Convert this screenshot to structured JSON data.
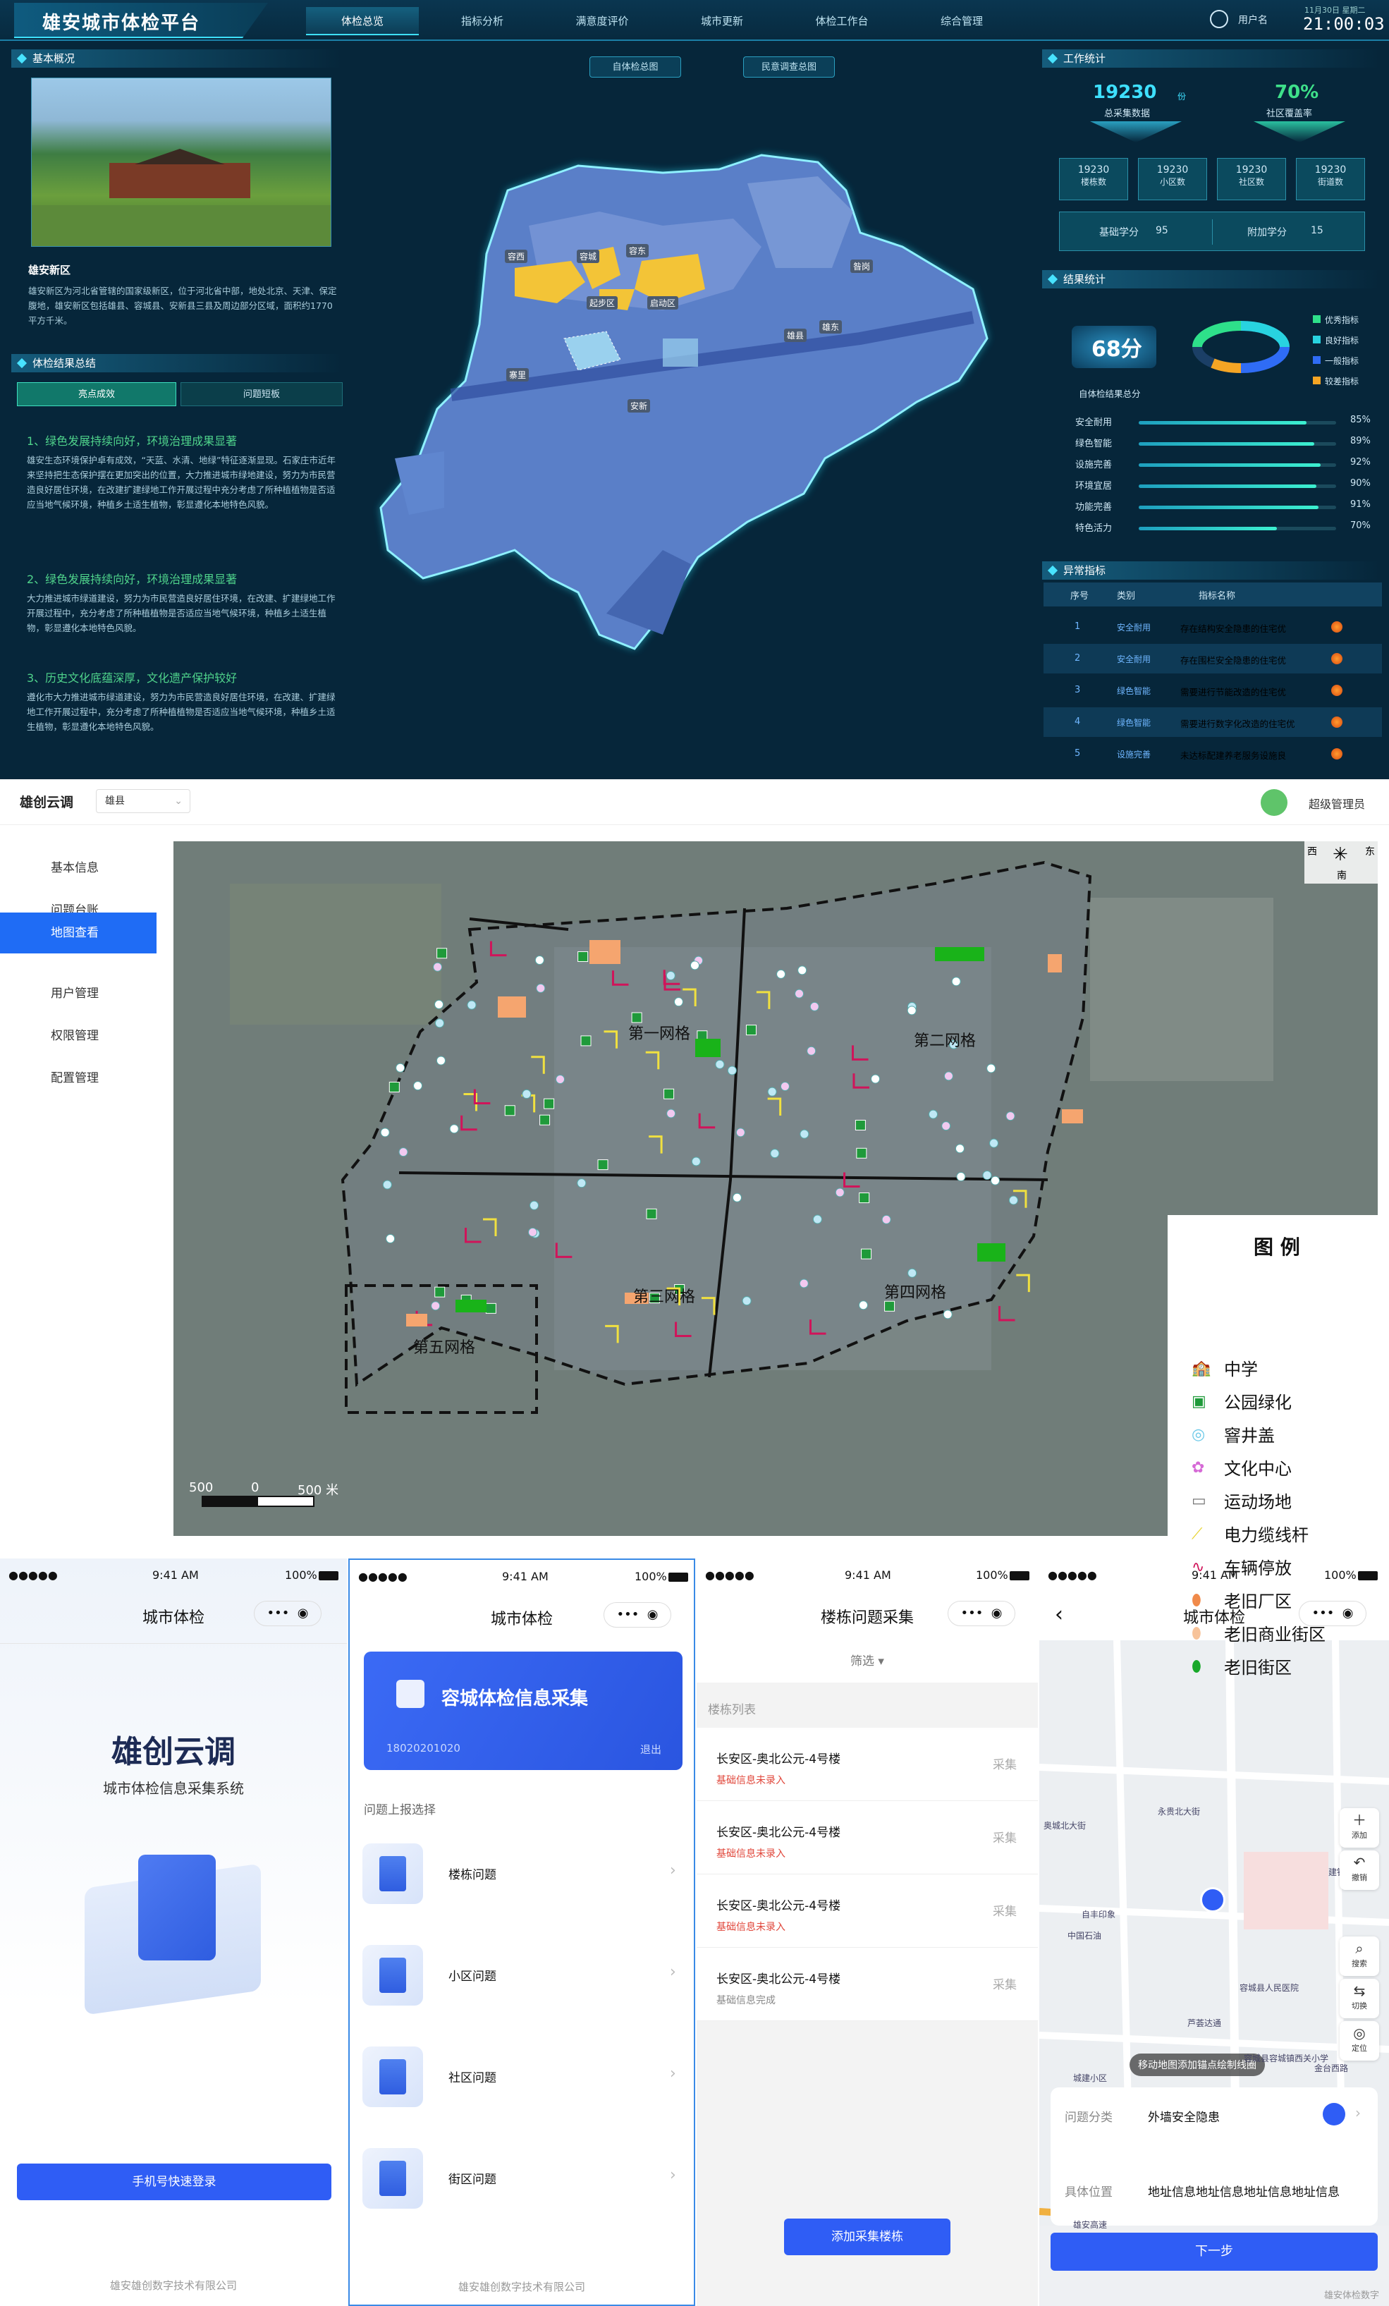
{
  "dashboard": {
    "title": "雄安城市体检平台",
    "nav": [
      "体检总览",
      "指标分析",
      "满意度评价",
      "城市更新",
      "体检工作台",
      "综合管理"
    ],
    "user": "用户名",
    "date": "11月30日 星期二",
    "time": "21:00:03",
    "overview_title": "基本概况",
    "region_name": "雄安新区",
    "region_desc": "雄安新区为河北省管辖的国家级新区，位于河北省中部，地处北京、天津、保定腹地，雄安新区包括雄县、容城县、安新县三县及周边部分区域，面积约1770平方千米。",
    "summary_title": "体检结果总结",
    "summary_tabs": [
      "亮点成效",
      "问题短板"
    ],
    "highlights": [
      {
        "title": "1、绿色发展持续向好，环境治理成果显著",
        "text": "雄安生态环境保护卓有成效，“天蓝、水清、地绿”特征逐渐显现。石家庄市近年来坚持把生态保护摆在更加突出的位置，大力推进城市绿地建设，努力为市民营造良好居住环境，在改建扩建绿地工作开展过程中充分考虑了所种植植物是否适应当地气候环境，种植乡土适生植物，彰显遵化本地特色风貌。"
      },
      {
        "title": "2、绿色发展持续向好，环境治理成果显著",
        "text": "大力推进城市绿道建设，努力为市民营造良好居住环境，在改建、扩建绿地工作开展过程中，充分考虑了所种植植物是否适应当地气候环境，种植乡土适生植物，彰显遵化本地特色风貌。"
      },
      {
        "title": "3、历史文化底蕴深厚，文化遗产保护较好",
        "text": "遵化市大力推进城市绿道建设，努力为市民营造良好居住环境，在改建、扩建绿地工作开展过程中，充分考虑了所种植植物是否适应当地气候环境，种植乡土适生植物，彰显遵化本地特色风貌。"
      }
    ],
    "map_buttons": [
      "自体检总图",
      "民意调查总图"
    ],
    "map_labels": [
      "容西",
      "容城",
      "容东",
      "昝岗",
      "起步区",
      "启动区",
      "雄县",
      "雄东",
      "寨里",
      "安新"
    ],
    "work_title": "工作统计",
    "total_label": "总采集数据",
    "total_value": "19230",
    "total_unit": "份",
    "coverage_label": "社区覆盖率",
    "coverage_value": "70%",
    "small_stats": [
      {
        "value": "19230",
        "label": "楼栋数"
      },
      {
        "value": "19230",
        "label": "小区数"
      },
      {
        "value": "19230",
        "label": "社区数"
      },
      {
        "value": "19230",
        "label": "街道数"
      }
    ],
    "base_score_label": "基础学分",
    "base_score": "95",
    "extra_score_label": "附加学分",
    "extra_score": "15",
    "result_title": "结果统计",
    "result_score": "68分",
    "result_label": "自体检结果总分",
    "donut_legend": [
      {
        "label": "优秀指标",
        "color": "#2ee08a"
      },
      {
        "label": "良好指标",
        "color": "#28d3e0"
      },
      {
        "label": "一般指标",
        "color": "#2f6cf5"
      },
      {
        "label": "较差指标",
        "color": "#f5a524"
      }
    ],
    "bars": [
      {
        "label": "安全耐用",
        "value": 85,
        "text": "85%"
      },
      {
        "label": "绿色智能",
        "value": 89,
        "text": "89%"
      },
      {
        "label": "设施完善",
        "value": 92,
        "text": "92%"
      },
      {
        "label": "环境宜居",
        "value": 90,
        "text": "90%"
      },
      {
        "label": "功能完善",
        "value": 91,
        "text": "91%"
      },
      {
        "label": "特色活力",
        "value": 70,
        "text": "70%"
      }
    ],
    "abnormal_title": "异常指标",
    "abnormal_headers": [
      "序号",
      "类别",
      "指标名称"
    ],
    "abnormal_rows": [
      {
        "no": "1",
        "cat": "安全耐用",
        "name": "存在结构安全隐患的住宅优"
      },
      {
        "no": "2",
        "cat": "安全耐用",
        "name": "存在围栏安全隐患的住宅优"
      },
      {
        "no": "3",
        "cat": "绿色智能",
        "name": "需要进行节能改造的住宅优"
      },
      {
        "no": "4",
        "cat": "绿色智能",
        "name": "需要进行数字化改造的住宅优"
      },
      {
        "no": "5",
        "cat": "设施完善",
        "name": "未达标配建养老服务设施良"
      }
    ]
  },
  "admin": {
    "brand": "雄创云调",
    "county": "雄县",
    "admin_user": "超级管理员",
    "menu": [
      "基本信息",
      "问题台账",
      "地图查看",
      "用户管理",
      "权限管理",
      "配置管理"
    ],
    "grids": [
      "第一网格",
      "第二网格",
      "第三网格",
      "第四网格",
      "第五网格"
    ],
    "legend_title": "图 例",
    "legend": [
      "中学",
      "公园绿化",
      "窨井盖",
      "文化中心",
      "运动场地",
      "电力缆线杆",
      "车辆停放",
      "老旧厂区",
      "老旧商业街区",
      "老旧街区"
    ],
    "scale": [
      "500",
      "0",
      "500 米"
    ],
    "compass": {
      "w": "西",
      "e": "东",
      "s": "南"
    }
  },
  "phones": {
    "time": "9:41 AM",
    "battery": "100%",
    "p1": {
      "title": "城市体检",
      "brand": "雄创云调",
      "subtitle": "城市体检信息采集系统",
      "login": "手机号快速登录",
      "footer": "雄安雄创数字技术有限公司"
    },
    "p2": {
      "title": "城市体检",
      "banner": "容城体检信息采集",
      "phone": "18020201020",
      "logout": "退出",
      "section": "问题上报选择",
      "items": [
        "楼栋问题",
        "小区问题",
        "社区问题",
        "街区问题"
      ],
      "footer": "雄安雄创数字技术有限公司"
    },
    "p3": {
      "title": "楼栋问题采集",
      "filter": "筛选",
      "list_header": "楼栋列表",
      "rows": [
        {
          "name": "长安区-奥北公元-4号楼",
          "status": "基础信息未录入",
          "action": "采集"
        },
        {
          "name": "长安区-奥北公元-4号楼",
          "status": "基础信息未录入",
          "action": "采集"
        },
        {
          "name": "长安区-奥北公元-4号楼",
          "status": "基础信息未录入",
          "action": "采集"
        },
        {
          "name": "长安区-奥北公元-4号楼",
          "status": "基础信息完成",
          "action": "采集"
        }
      ],
      "add": "添加采集楼栋"
    },
    "p4": {
      "title": "城市体检",
      "tip": "移动地图添加锚点绘制线圈",
      "cat_label": "问题分类",
      "cat_value": "外墙安全隐患",
      "loc_label": "具体位置",
      "loc_value": "地址信息地址信息地址信息地址信息",
      "next": "下一步",
      "tools": [
        "添加",
        "撤销",
        "搜索",
        "切换",
        "定位"
      ],
      "pois": [
        "容城县人民医院",
        "中国石油",
        "自丰印象",
        "芦荟达通",
        "容城县容城镇西关小学",
        "城建小区",
        "金台西路",
        "建铁街",
        "奥城北大街",
        "永贵北大街",
        "雄安高速"
      ]
    },
    "watermark": "雄安体检数字"
  }
}
